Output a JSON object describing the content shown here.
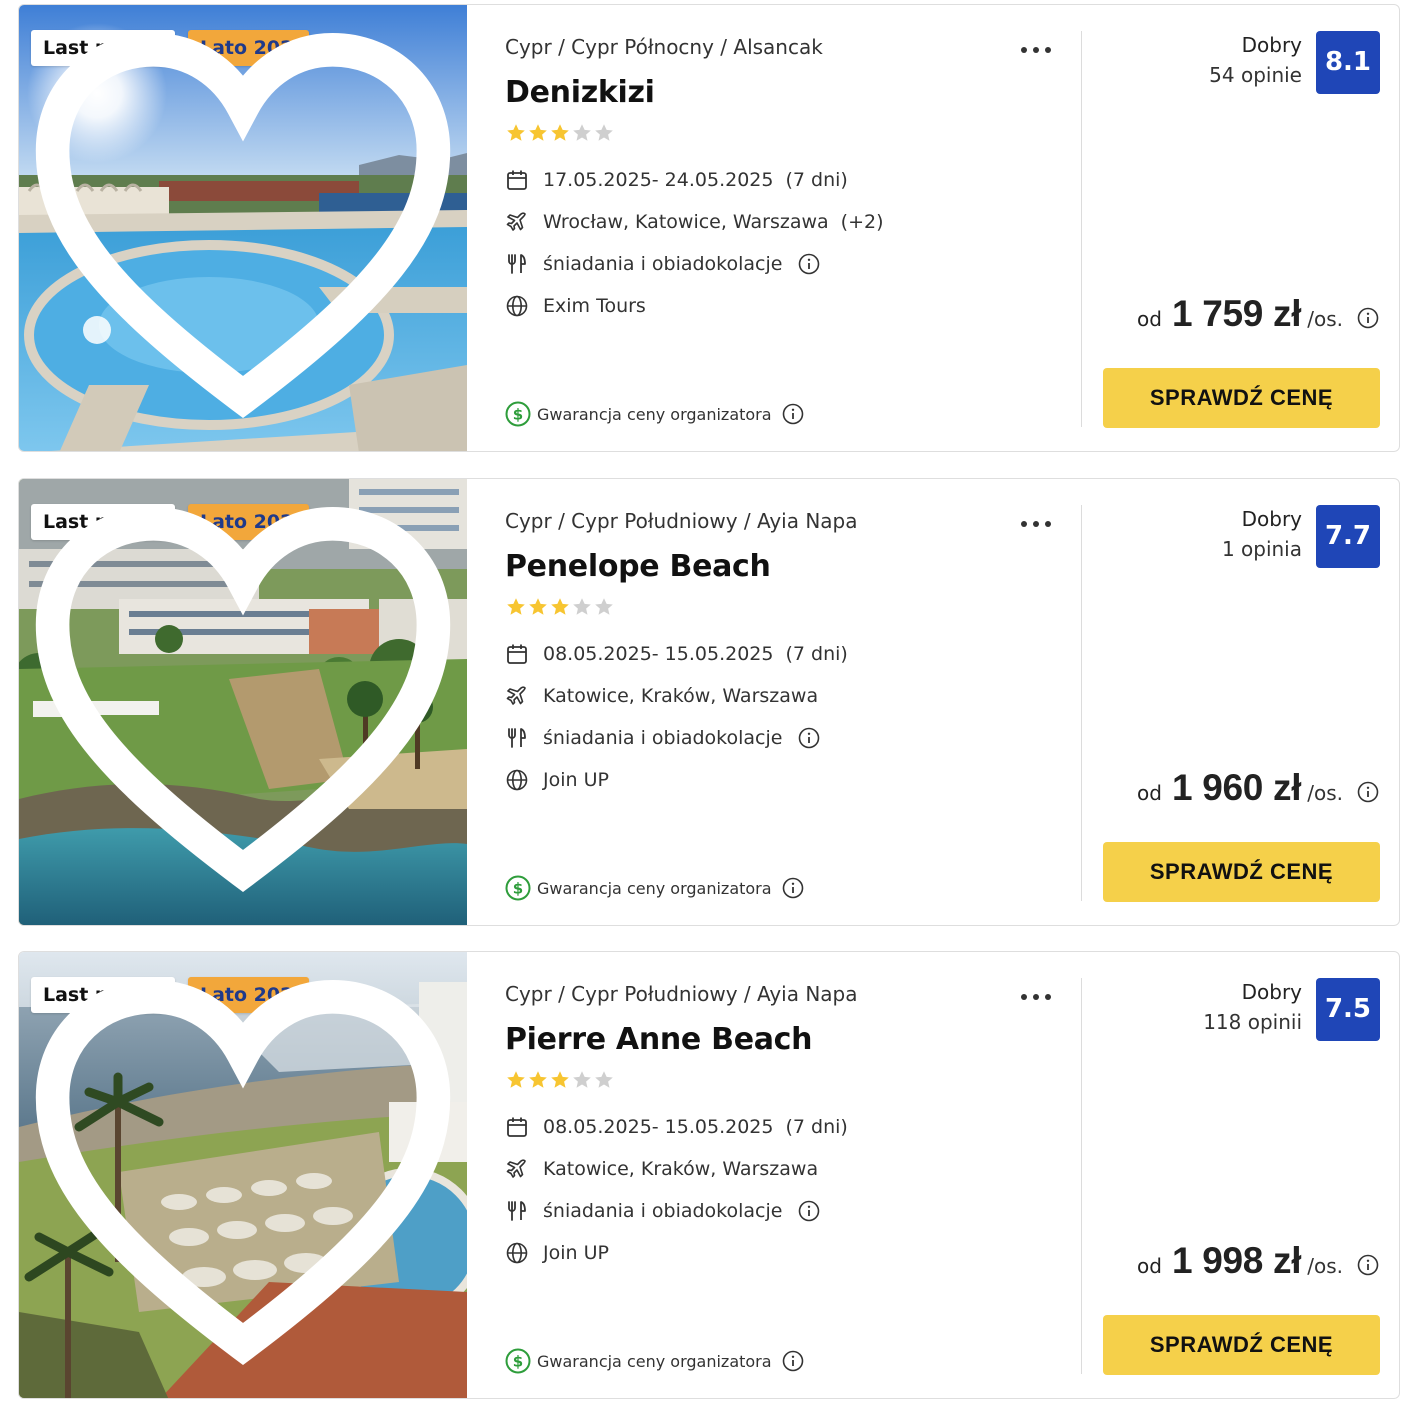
{
  "common": {
    "tag_last_minute": "Last minute",
    "tag_season": "Lato 2025",
    "guarantee_text": "Gwarancja ceny organizatora",
    "price_prefix": "od",
    "price_suffix": "/os.",
    "cta_label": "SPRAWDŹ CENĘ",
    "icons": {
      "favorite": "heart-outline-icon",
      "menu": "more-dots-icon",
      "dates": "calendar-icon",
      "airports": "plane-icon",
      "board": "fork-knife-icon",
      "operator": "globe-icon",
      "info": "info-circle-icon",
      "guarantee": "dollar-circle-icon"
    },
    "colors": {
      "season_tag_bg": "#f2a73b",
      "season_tag_text": "#1f3a8a",
      "rating_badge": "#1f46b7",
      "cta_bg": "#f5d04a",
      "star_filled": "#f7c531",
      "star_empty": "#cfcfcf",
      "guarantee_green": "#2e9d3b"
    }
  },
  "offers": [
    {
      "location": "Cypr / Cypr Północny / Alsancak",
      "name": "Denizkizi",
      "stars_total": 5,
      "stars_filled": 3,
      "dates": "17.05.2025- 24.05.2025",
      "duration": "(7 dni)",
      "airports": "Wrocław, Katowice, Warszawa",
      "airports_extra": "(+2)",
      "board": "śniadania i obiadokolacje",
      "operator": "Exim Tours",
      "rating_label": "Dobry",
      "rating_count": "54 opinie",
      "rating_score": "8.1",
      "price": "1 759 zł"
    },
    {
      "location": "Cypr / Cypr Południowy / Ayia Napa",
      "name": "Penelope Beach",
      "stars_total": 5,
      "stars_filled": 3,
      "dates": "08.05.2025- 15.05.2025",
      "duration": "(7 dni)",
      "airports": "Katowice, Kraków, Warszawa",
      "airports_extra": "",
      "board": "śniadania i obiadokolacje",
      "operator": "Join UP",
      "rating_label": "Dobry",
      "rating_count": "1 opinia",
      "rating_score": "7.7",
      "price": "1 960 zł"
    },
    {
      "location": "Cypr / Cypr Południowy / Ayia Napa",
      "name": "Pierre Anne Beach",
      "stars_total": 5,
      "stars_filled": 3,
      "dates": "08.05.2025- 15.05.2025",
      "duration": "(7 dni)",
      "airports": "Katowice, Kraków, Warszawa",
      "airports_extra": "",
      "board": "śniadania i obiadokolacje",
      "operator": "Join UP",
      "rating_label": "Dobry",
      "rating_count": "118 opinii",
      "rating_score": "7.5",
      "price": "1 998 zł"
    }
  ]
}
